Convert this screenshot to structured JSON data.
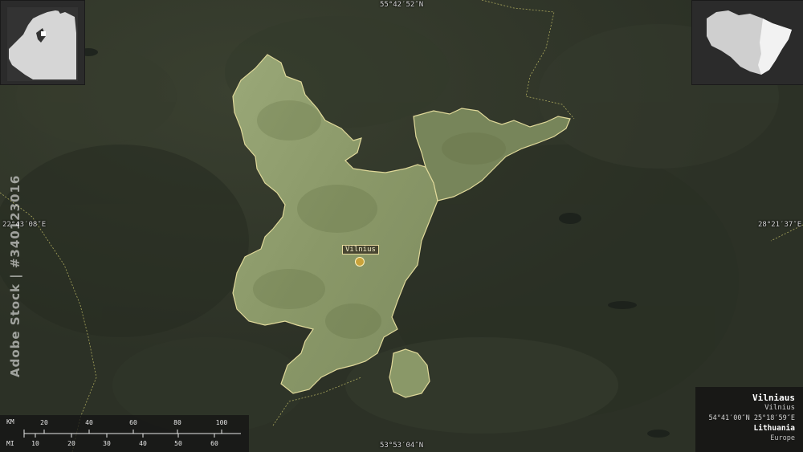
{
  "map": {
    "region_name": "Vilniaus",
    "capital_label": "Vilnius",
    "colors": {
      "background": "#2f3428",
      "region_fill": "#8c9a6a",
      "region_border": "#d8d29a",
      "inset_land": "#d6d6d6",
      "inset_highlight": "#f2f2f2"
    }
  },
  "coords": {
    "top": "55°42′52″N",
    "bottom": "53°53′04″N",
    "left": "22°43′08″E",
    "right": "28°21′37″E"
  },
  "scale": {
    "km_label": "KM",
    "mi_label": "MI",
    "km_ticks": [
      "20",
      "40",
      "60",
      "80",
      "100"
    ],
    "mi_ticks": [
      "10",
      "20",
      "30",
      "40",
      "50",
      "60"
    ]
  },
  "info": {
    "title": "Vilniaus",
    "subtitle": "Vilnius",
    "coordinates": "54°41′00″N 25°18′59″E",
    "country": "Lithuania",
    "continent": "Europe"
  },
  "watermark": "Adobe Stock | #340123016"
}
